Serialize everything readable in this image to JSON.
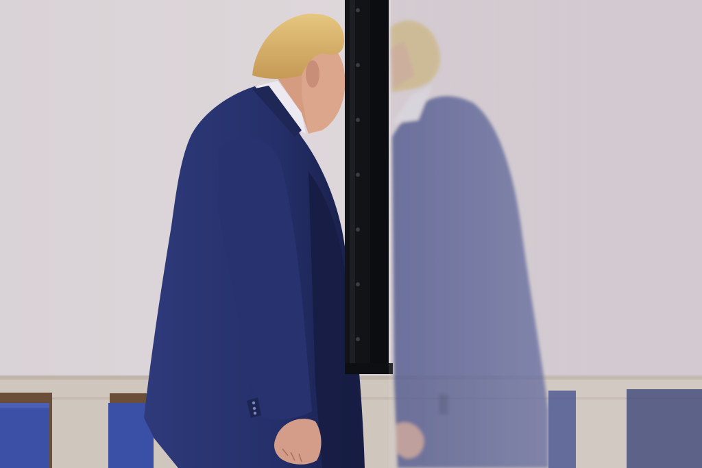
{
  "image": {
    "kind": "photograph",
    "colors": {
      "wall": "#d6cfd2",
      "wall_shadow": "#bdb6bb",
      "baseboard": "#c9c0b8",
      "suit": "#2a3570",
      "suit_dark": "#1c2452",
      "hair": "#d8b46a",
      "skin": "#d9a48a",
      "shirt": "#eceaf0",
      "door_edge": "#121316",
      "chair_blue": "#3a4fa8",
      "chair_wood": "#6b4e38",
      "reflection": "#7078a6"
    }
  }
}
